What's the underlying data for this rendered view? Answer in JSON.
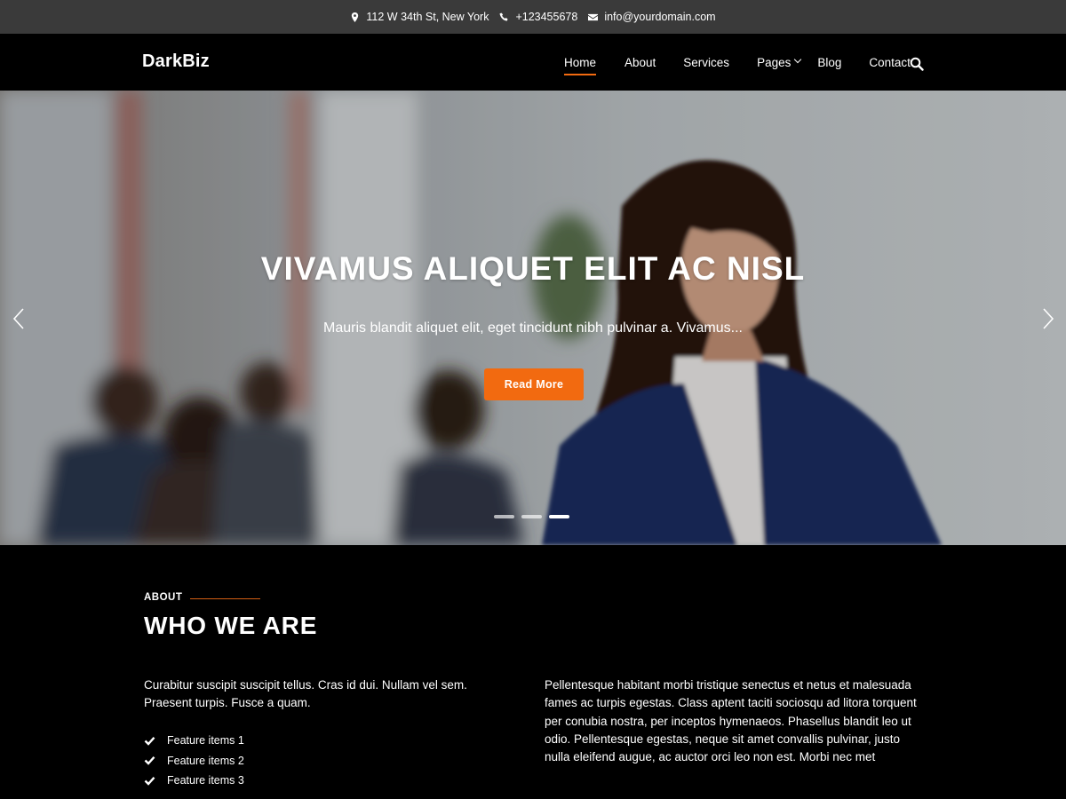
{
  "topbar": {
    "address": "112 W 34th St, New York",
    "phone": "+123455678",
    "email": "info@yourdomain.com"
  },
  "header": {
    "logo": "DarkBiz",
    "nav": [
      {
        "label": "Home"
      },
      {
        "label": "About"
      },
      {
        "label": "Services"
      },
      {
        "label": "Pages"
      },
      {
        "label": "Blog"
      },
      {
        "label": "Contact"
      }
    ],
    "search_icon": "search-icon"
  },
  "hero": {
    "title": "VIVAMUS ALIQUET ELIT AC NISL",
    "subtitle": "Mauris blandit aliquet elit, eget tincidunt nibh pulvinar a. Vivamus...",
    "button": "Read More",
    "slide_count": 3,
    "active_slide": 3
  },
  "about": {
    "label": "ABOUT",
    "title": "WHO WE ARE",
    "left_text": "Curabitur suscipit suscipit tellus. Cras id dui. Nullam vel sem. Praesent turpis. Fusce a quam.",
    "features": [
      "Feature items 1",
      "Feature items 2",
      "Feature items 3"
    ],
    "right_text": "Pellentesque habitant morbi tristique senectus et netus et malesuada fames ac turpis egestas. Class aptent taciti sociosqu ad litora torquent per conubia nostra, per inceptos hymenaeos. Phasellus blandit leo ut odio. Pellentesque egestas, neque sit amet convallis pulvinar, justo nulla eleifend augue, ac auctor orci leo non est. Morbi nec met"
  },
  "colors": {
    "accent": "#f26a10",
    "topbar": "#3a3a3a",
    "background": "#000000"
  }
}
